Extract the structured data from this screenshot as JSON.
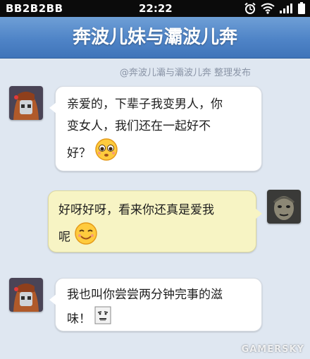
{
  "status_bar": {
    "carrier": "BB2B2BB",
    "time": "22:22",
    "icons": [
      "alarm-clock-icon",
      "wifi-icon",
      "signal-bars-icon",
      "battery-icon"
    ]
  },
  "title": "奔波儿妹与灞波儿奔",
  "credit": "@奔波儿灞与灞波儿奔 整理发布",
  "messages": [
    {
      "side": "left",
      "lines": [
        "亲爱的，下辈子我变男人，你",
        "变女人，我们还在一起好不",
        "好？"
      ],
      "emoji": "pleading-face-emoji"
    },
    {
      "side": "right",
      "lines": [
        "好呀好呀，看来你还真是爱我",
        "呢"
      ],
      "emoji": "smiling-face-emoji"
    },
    {
      "side": "left",
      "lines": [
        "我也叫你尝尝两分钟完事的滋",
        "味！"
      ],
      "emoji": "meme-face-emoji"
    }
  ],
  "watermark": "GAMERSKY",
  "colors": {
    "title_bar": "#4f84c7",
    "left_bubble": "#ffffff",
    "right_bubble": "#f7f4c4",
    "background": "#dfe7f1"
  }
}
